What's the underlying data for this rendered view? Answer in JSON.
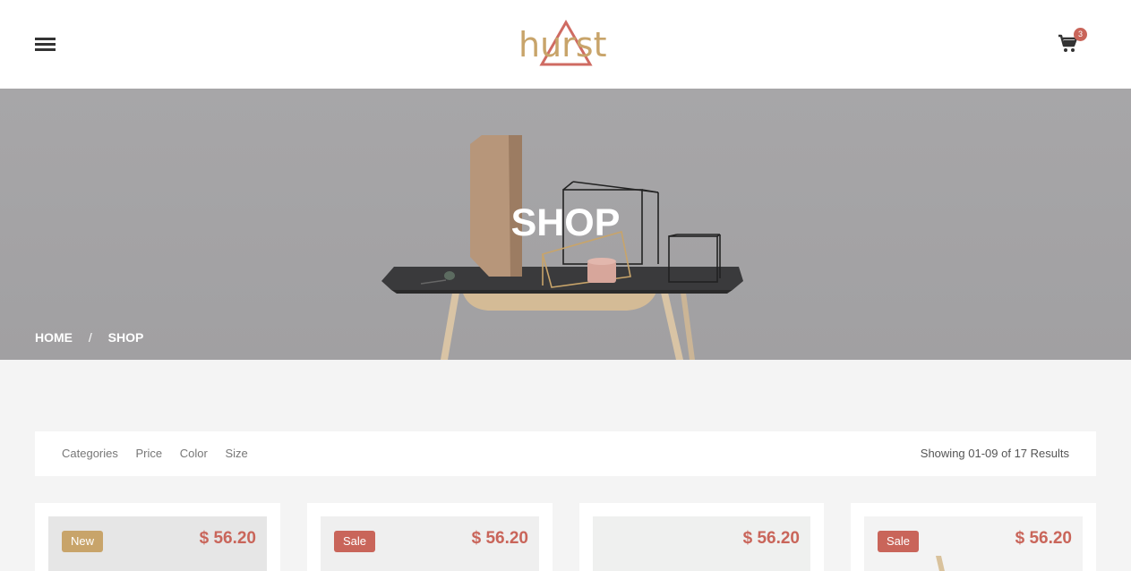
{
  "header": {
    "logo_text": "hurst",
    "cart_count": "3",
    "menu_icon": "hamburger-icon",
    "cart_icon": "cart-icon"
  },
  "hero": {
    "title": "SHOP",
    "breadcrumb": {
      "home": "HOME",
      "separator": "/",
      "current": "SHOP"
    }
  },
  "filters": {
    "items": [
      "Categories",
      "Price",
      "Color",
      "Size"
    ],
    "results_text": "Showing 01-09 of 17 Results"
  },
  "products": [
    {
      "badge": "New",
      "badge_type": "new",
      "price": "$ 56.20"
    },
    {
      "badge": "Sale",
      "badge_type": "sale",
      "price": "$ 56.20"
    },
    {
      "badge": "",
      "badge_type": "",
      "price": "$ 56.20"
    },
    {
      "badge": "Sale",
      "badge_type": "sale",
      "price": "$ 56.20"
    }
  ],
  "colors": {
    "accent_gold": "#c8a46a",
    "accent_red": "#c9655a"
  }
}
